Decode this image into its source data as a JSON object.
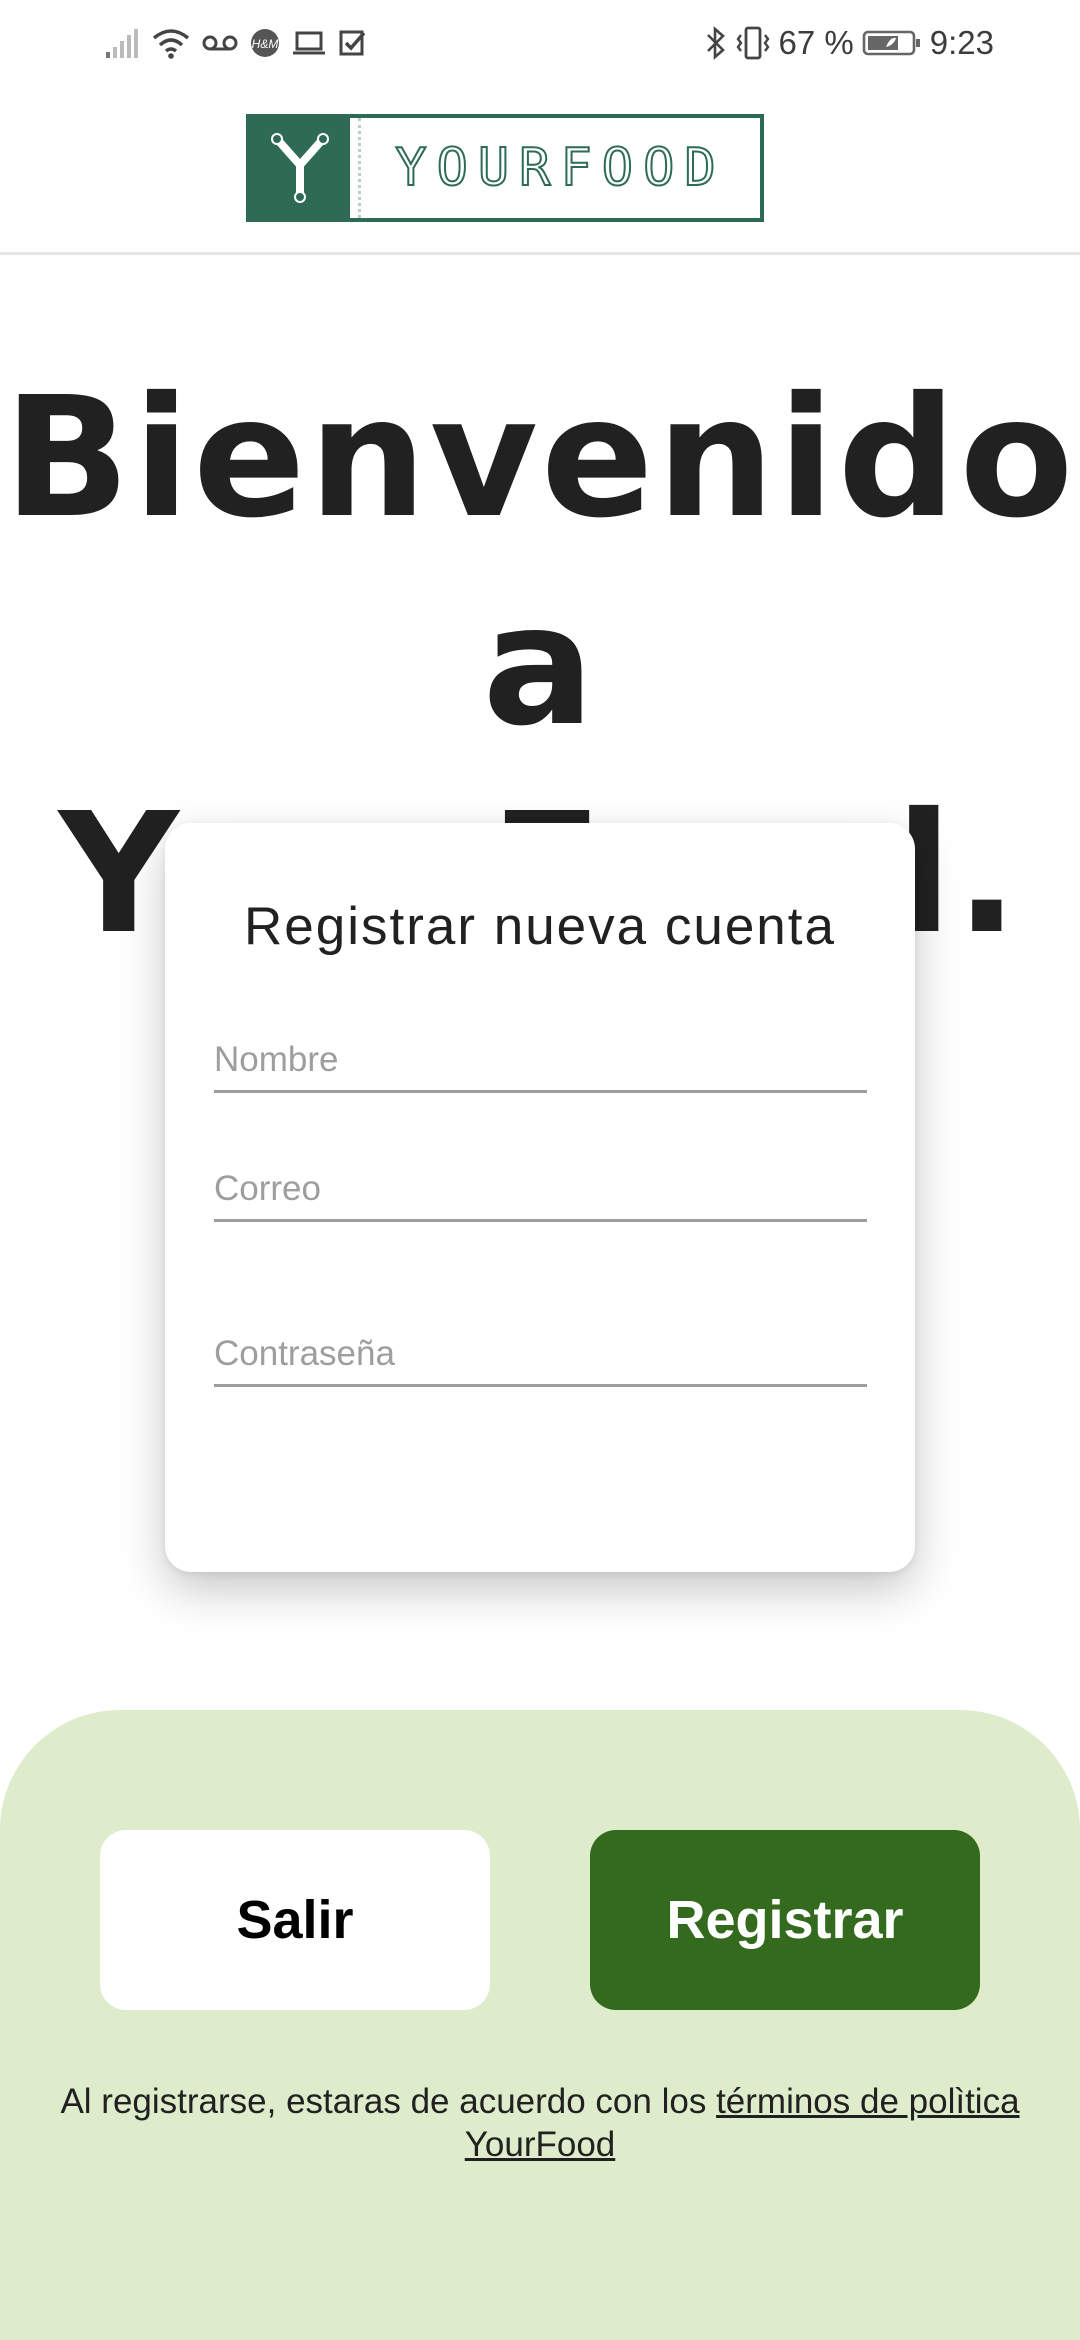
{
  "status_bar": {
    "icons_left": [
      "signal-icon",
      "wifi-icon",
      "voicemail-icon",
      "hm-app-icon",
      "laptop-icon",
      "check-icon"
    ],
    "icons_right": [
      "bluetooth-icon",
      "vibrate-icon",
      "battery-icon"
    ],
    "battery_percent": "67 %",
    "time": "9:23"
  },
  "header": {
    "logo_text": "YOURFOOD",
    "logo_mark": "Y",
    "brand_color": "#2e6b55"
  },
  "welcome": {
    "line1": "Bienvenido",
    "line2": "a YourFood."
  },
  "form": {
    "title": "Registrar nueva cuenta",
    "name_placeholder": "Nombre",
    "name_value": "",
    "email_placeholder": "Correo",
    "email_value": "",
    "password_placeholder": "Contraseña",
    "password_value": ""
  },
  "actions": {
    "exit_label": "Salir",
    "register_label": "Registrar",
    "primary_color": "#336a1e",
    "sheet_color": "#dfeccb"
  },
  "terms": {
    "prefix": "Al registrarse, estaras de acuerdo con los ",
    "link_text": "términos de polìtica YourFood"
  }
}
